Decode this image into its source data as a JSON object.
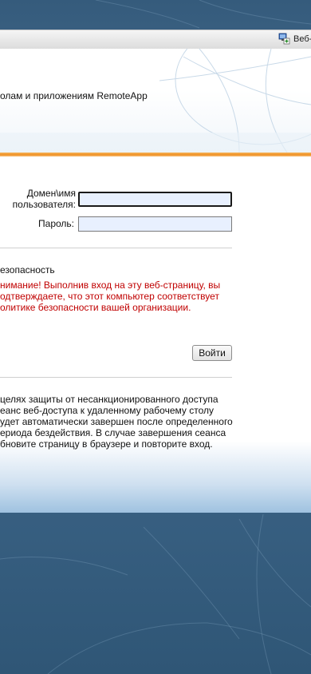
{
  "header": {
    "webaccess_link": "Веб-"
  },
  "banner": {
    "subtitle": "олам и приложениям RemoteApp"
  },
  "form": {
    "username_label": "Домен\\имя пользователя:",
    "username_value": "",
    "password_label": "Пароль:",
    "password_value": ""
  },
  "security": {
    "title": "езопасность",
    "warning": "нимание! Выполнив вход на эту веб-страницу, вы одтверждаете, что этот компьютер соответствует олитике безопасности вашей организации."
  },
  "login_button": "Войти",
  "info_text": " целях защиты от несанкционированного доступа еанс веб-доступа к удаленному рабочему столу удет автоматически завершен после определенного ериода бездействия. В случае завершения сеанса бновите страницу в браузере и повторите вход.",
  "colors": {
    "accent_orange": "#ef8f22",
    "warning_red": "#c00000",
    "background_blue": "#4a7192"
  }
}
